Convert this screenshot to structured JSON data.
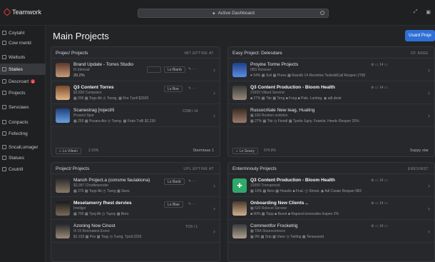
{
  "app": {
    "brand": "Teamwork",
    "search_label": "Active Dashboard"
  },
  "sidebar": {
    "items": [
      {
        "label": "Coytaht"
      },
      {
        "label": "Cow rnertd"
      },
      {
        "label": "Waltuds"
      },
      {
        "label": "Staties"
      },
      {
        "label": "Descroart",
        "badge": "1"
      },
      {
        "label": "Projects"
      },
      {
        "label": "Servciaes"
      },
      {
        "label": "Conpacts"
      },
      {
        "label": "Fefecting"
      },
      {
        "label": "Sncall,umager"
      },
      {
        "label": "Statues"
      },
      {
        "label": "Coutrill"
      }
    ]
  },
  "main": {
    "title": "Main Projects",
    "primary_button": "Usard Proje"
  },
  "panels": [
    {
      "title": "Projec/ Projects",
      "meta": "IMT EPTINE AT",
      "rows": [
        {
          "title": "Brand Update - Torres Studio",
          "sub": "III Irbnead",
          "value": "20.2%",
          "chip1": "",
          "chip2": "Lo Bianb",
          "meta1": "",
          "meta2": "",
          "meta3": "",
          "meta4": ""
        },
        {
          "title": "Q3 Content Torres",
          "sub": "$3,830 Campalon",
          "value": "▦ 200   ▦ Togo   Ati   ◷ Toeng.   ▦ Fire   Tpoll   $2920",
          "chip1": "Lo Boe"
        },
        {
          "title": "Scanestrag [roject/li",
          "sub": "Prosect Spot",
          "value": "▦ 250   ▦ Posara   Ato   ◷ Tseng.   ▦ Frale   Tvilll   $2,230",
          "chip1": "COM I 14"
        }
      ],
      "foot_chip": "Lo Vdesn",
      "foot_chip_count": "2.15%",
      "foot_right": "Starmtaas",
      "foot_count": "1"
    },
    {
      "title": "Easy Project: Delesdare",
      "meta": "OF AREE",
      "rows": [
        {
          "title": "Proyine Torme Projects",
          "sub": "IIBS Resexer",
          "value": "♥ 54%   ▦ Soil   ▦ Prees   ▦ Raoolb   14 Receitive   TesleddCall   Respon   2790"
        },
        {
          "title": "Q3 Content Production - Bloom Health",
          "sub": "31993 Vifiard Servind",
          "value": "■ 27%   ▦ Tite   ▦ Teng   ■ Fsng   ■ Pale.   Lunitng.   ◉ adl.dnstr"
        },
        {
          "title": "Russocritale New leag, Hualing",
          "sub": "▦ 160 Rootion sorbdon",
          "value": "▦ 27%   ▦ Tite   ◷ Fiendl   ▦ Tpeilo   Jujny.   Feanlst.   Heedc   Respon   25%"
        }
      ],
      "foot_chip": "Lo Seany",
      "foot_chip_count": "574.0%",
      "foot_right": "Suppy star"
    },
    {
      "title": "Project/ Projects",
      "meta": "UPL EPTINE AT",
      "rows": [
        {
          "title": "Manch Project.a (consme faulakiona)",
          "sub": "$3,997  Chodtewonder",
          "value": "▦ 270   ▦ Topp   Ati   ◷ Tuerg   ▦ Sees",
          "chip1": "Lo Banb"
        },
        {
          "title": "Meselamerry fhest  dervies",
          "sub": "Imellger",
          "value": "▦ 700   ▦ Tpoj   Ati   ◷ Tupoy   ▦ Bero",
          "chip1": "Lo Blae"
        },
        {
          "title": "Azoning Now Cinost",
          "sub": "III 15 Brinmatest Exent",
          "value": "$1 233   ▦ Pov   ▦ Toqy   ◷ Tuerg.   Tpoll   2220",
          "chip1": "TOS I 1"
        }
      ]
    },
    {
      "title": "Entermnouly Projects",
      "meta": "ERESINST",
      "rows": [
        {
          "title": "Q3 Content Production - Bloom Health",
          "sub": "10350 Trensprocot",
          "value": "▦ 10%   ▦ Bers   ▦ Hoazile   ■ Fnal.   ◷ Showt.   ◉ Adl Cwate   Respan   5B2"
        },
        {
          "title": "Onboarding New Clients ..",
          "sub": "▦ 620 Rolecet Servioe",
          "value": "■ 90%   ▦ Topp   ■ Bunot   ■ Rapond inoveodes   Inspen   2%"
        },
        {
          "title": "Commentfor Frocketrig",
          "sub": "▦ TBA Stouncomrece",
          "value": "▦ 9%   ▦ Srip   ▦ Vieor   ◷ Twitlng   ▦ Tenessoott"
        }
      ]
    }
  ]
}
